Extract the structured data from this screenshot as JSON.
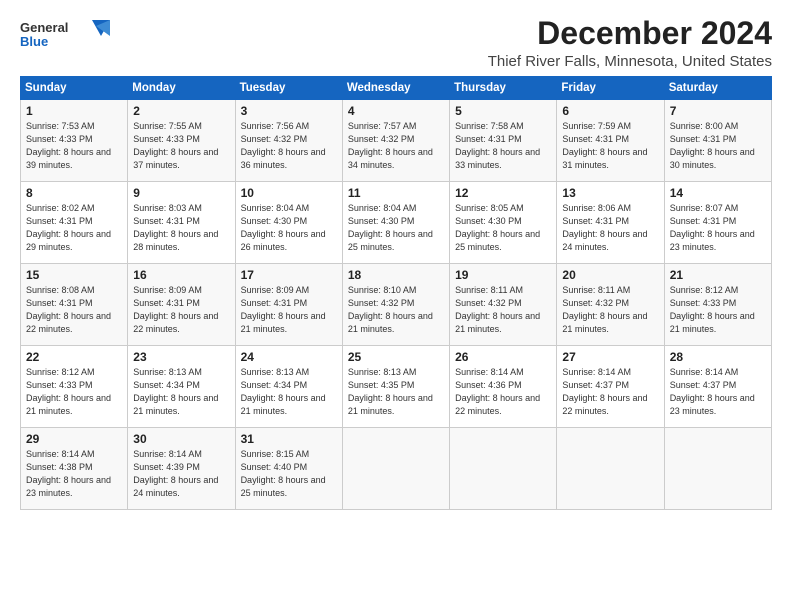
{
  "logo": {
    "general": "General",
    "blue": "Blue"
  },
  "header": {
    "month": "December 2024",
    "location": "Thief River Falls, Minnesota, United States"
  },
  "weekdays": [
    "Sunday",
    "Monday",
    "Tuesday",
    "Wednesday",
    "Thursday",
    "Friday",
    "Saturday"
  ],
  "weeks": [
    [
      {
        "day": "1",
        "sunrise": "Sunrise: 7:53 AM",
        "sunset": "Sunset: 4:33 PM",
        "daylight": "Daylight: 8 hours and 39 minutes."
      },
      {
        "day": "2",
        "sunrise": "Sunrise: 7:55 AM",
        "sunset": "Sunset: 4:33 PM",
        "daylight": "Daylight: 8 hours and 37 minutes."
      },
      {
        "day": "3",
        "sunrise": "Sunrise: 7:56 AM",
        "sunset": "Sunset: 4:32 PM",
        "daylight": "Daylight: 8 hours and 36 minutes."
      },
      {
        "day": "4",
        "sunrise": "Sunrise: 7:57 AM",
        "sunset": "Sunset: 4:32 PM",
        "daylight": "Daylight: 8 hours and 34 minutes."
      },
      {
        "day": "5",
        "sunrise": "Sunrise: 7:58 AM",
        "sunset": "Sunset: 4:31 PM",
        "daylight": "Daylight: 8 hours and 33 minutes."
      },
      {
        "day": "6",
        "sunrise": "Sunrise: 7:59 AM",
        "sunset": "Sunset: 4:31 PM",
        "daylight": "Daylight: 8 hours and 31 minutes."
      },
      {
        "day": "7",
        "sunrise": "Sunrise: 8:00 AM",
        "sunset": "Sunset: 4:31 PM",
        "daylight": "Daylight: 8 hours and 30 minutes."
      }
    ],
    [
      {
        "day": "8",
        "sunrise": "Sunrise: 8:02 AM",
        "sunset": "Sunset: 4:31 PM",
        "daylight": "Daylight: 8 hours and 29 minutes."
      },
      {
        "day": "9",
        "sunrise": "Sunrise: 8:03 AM",
        "sunset": "Sunset: 4:31 PM",
        "daylight": "Daylight: 8 hours and 28 minutes."
      },
      {
        "day": "10",
        "sunrise": "Sunrise: 8:04 AM",
        "sunset": "Sunset: 4:30 PM",
        "daylight": "Daylight: 8 hours and 26 minutes."
      },
      {
        "day": "11",
        "sunrise": "Sunrise: 8:04 AM",
        "sunset": "Sunset: 4:30 PM",
        "daylight": "Daylight: 8 hours and 25 minutes."
      },
      {
        "day": "12",
        "sunrise": "Sunrise: 8:05 AM",
        "sunset": "Sunset: 4:30 PM",
        "daylight": "Daylight: 8 hours and 25 minutes."
      },
      {
        "day": "13",
        "sunrise": "Sunrise: 8:06 AM",
        "sunset": "Sunset: 4:31 PM",
        "daylight": "Daylight: 8 hours and 24 minutes."
      },
      {
        "day": "14",
        "sunrise": "Sunrise: 8:07 AM",
        "sunset": "Sunset: 4:31 PM",
        "daylight": "Daylight: 8 hours and 23 minutes."
      }
    ],
    [
      {
        "day": "15",
        "sunrise": "Sunrise: 8:08 AM",
        "sunset": "Sunset: 4:31 PM",
        "daylight": "Daylight: 8 hours and 22 minutes."
      },
      {
        "day": "16",
        "sunrise": "Sunrise: 8:09 AM",
        "sunset": "Sunset: 4:31 PM",
        "daylight": "Daylight: 8 hours and 22 minutes."
      },
      {
        "day": "17",
        "sunrise": "Sunrise: 8:09 AM",
        "sunset": "Sunset: 4:31 PM",
        "daylight": "Daylight: 8 hours and 21 minutes."
      },
      {
        "day": "18",
        "sunrise": "Sunrise: 8:10 AM",
        "sunset": "Sunset: 4:32 PM",
        "daylight": "Daylight: 8 hours and 21 minutes."
      },
      {
        "day": "19",
        "sunrise": "Sunrise: 8:11 AM",
        "sunset": "Sunset: 4:32 PM",
        "daylight": "Daylight: 8 hours and 21 minutes."
      },
      {
        "day": "20",
        "sunrise": "Sunrise: 8:11 AM",
        "sunset": "Sunset: 4:32 PM",
        "daylight": "Daylight: 8 hours and 21 minutes."
      },
      {
        "day": "21",
        "sunrise": "Sunrise: 8:12 AM",
        "sunset": "Sunset: 4:33 PM",
        "daylight": "Daylight: 8 hours and 21 minutes."
      }
    ],
    [
      {
        "day": "22",
        "sunrise": "Sunrise: 8:12 AM",
        "sunset": "Sunset: 4:33 PM",
        "daylight": "Daylight: 8 hours and 21 minutes."
      },
      {
        "day": "23",
        "sunrise": "Sunrise: 8:13 AM",
        "sunset": "Sunset: 4:34 PM",
        "daylight": "Daylight: 8 hours and 21 minutes."
      },
      {
        "day": "24",
        "sunrise": "Sunrise: 8:13 AM",
        "sunset": "Sunset: 4:34 PM",
        "daylight": "Daylight: 8 hours and 21 minutes."
      },
      {
        "day": "25",
        "sunrise": "Sunrise: 8:13 AM",
        "sunset": "Sunset: 4:35 PM",
        "daylight": "Daylight: 8 hours and 21 minutes."
      },
      {
        "day": "26",
        "sunrise": "Sunrise: 8:14 AM",
        "sunset": "Sunset: 4:36 PM",
        "daylight": "Daylight: 8 hours and 22 minutes."
      },
      {
        "day": "27",
        "sunrise": "Sunrise: 8:14 AM",
        "sunset": "Sunset: 4:37 PM",
        "daylight": "Daylight: 8 hours and 22 minutes."
      },
      {
        "day": "28",
        "sunrise": "Sunrise: 8:14 AM",
        "sunset": "Sunset: 4:37 PM",
        "daylight": "Daylight: 8 hours and 23 minutes."
      }
    ],
    [
      {
        "day": "29",
        "sunrise": "Sunrise: 8:14 AM",
        "sunset": "Sunset: 4:38 PM",
        "daylight": "Daylight: 8 hours and 23 minutes."
      },
      {
        "day": "30",
        "sunrise": "Sunrise: 8:14 AM",
        "sunset": "Sunset: 4:39 PM",
        "daylight": "Daylight: 8 hours and 24 minutes."
      },
      {
        "day": "31",
        "sunrise": "Sunrise: 8:15 AM",
        "sunset": "Sunset: 4:40 PM",
        "daylight": "Daylight: 8 hours and 25 minutes."
      },
      null,
      null,
      null,
      null
    ]
  ]
}
